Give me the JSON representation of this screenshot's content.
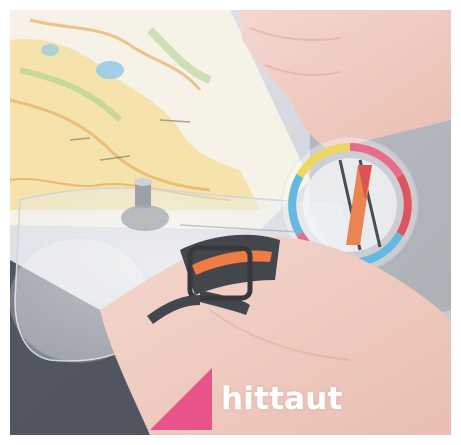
{
  "brand": {
    "wordmark": "hittaut",
    "accent_color": "#e8538a"
  },
  "scene": {
    "objects": [
      "orienteering-map",
      "thumb-compass",
      "hand",
      "elastic-strap"
    ]
  }
}
